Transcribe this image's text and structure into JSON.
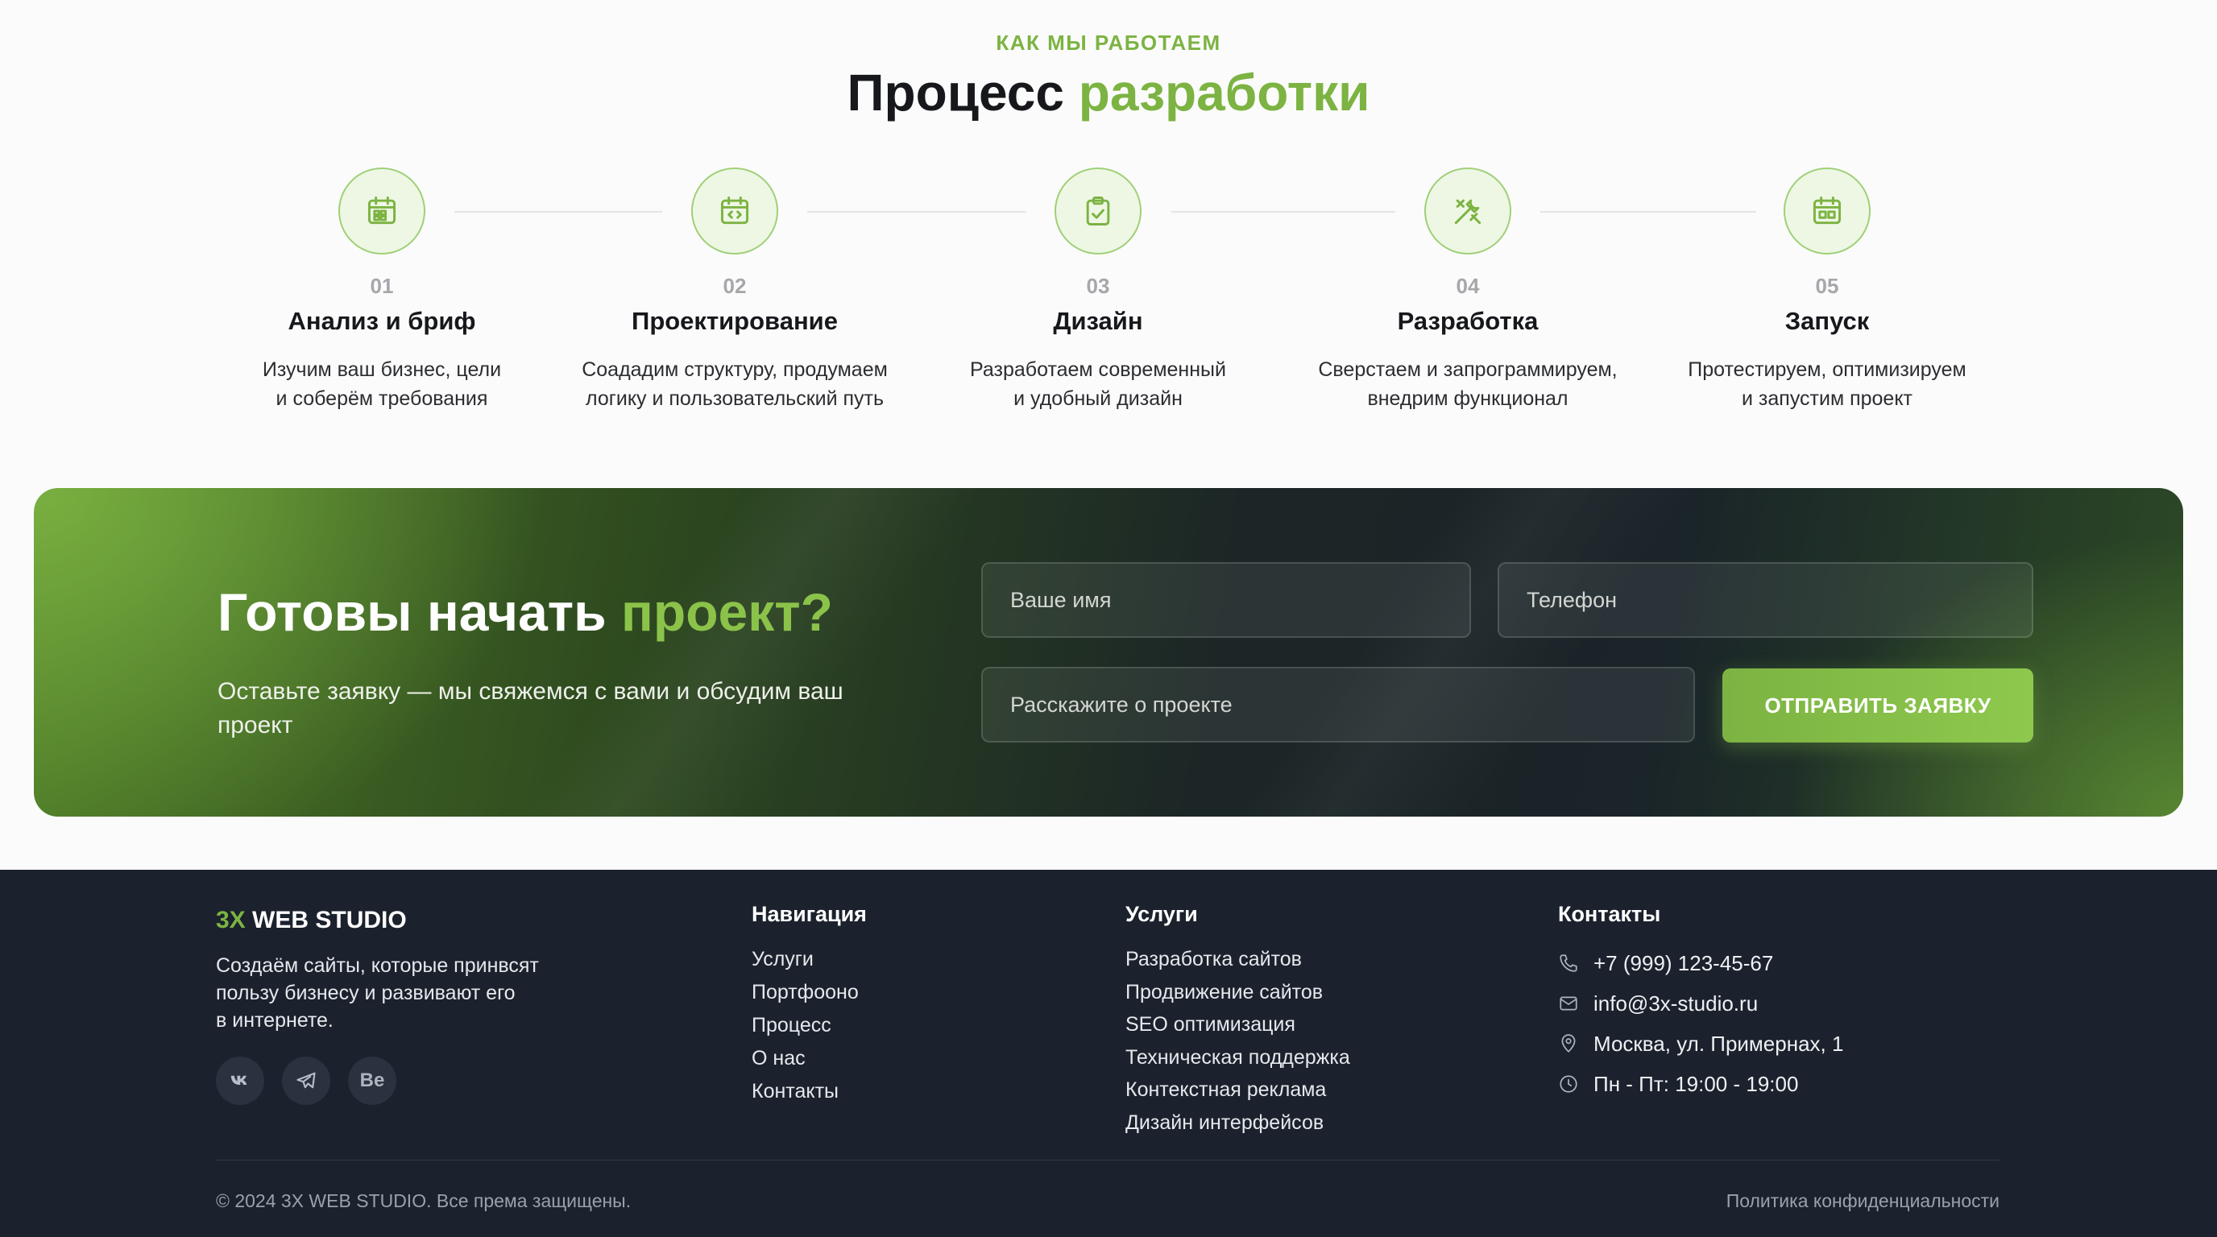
{
  "process": {
    "eyebrow": "КАК МЫ РАБОТАЕМ",
    "heading_main": "Процесс",
    "heading_accent": "разработки",
    "steps": [
      {
        "num": "01",
        "title": "Анализ и бриф",
        "desc": "Изучим ваш бизнес, цели\nи соберём требования",
        "icon": "calendar-grid-icon"
      },
      {
        "num": "02",
        "title": "Проектирование",
        "desc": "Соададим структуру, продумаем\nлогику и пользовательский путь",
        "icon": "calendar-code-icon"
      },
      {
        "num": "03",
        "title": "Дизайн",
        "desc": "Разработаем современный\nи удобный дизайн",
        "icon": "clipboard-check-icon"
      },
      {
        "num": "04",
        "title": "Разработка",
        "desc": "Сверстаем и запрограммируем,\nвнедрим функционал",
        "icon": "tools-icon"
      },
      {
        "num": "05",
        "title": "Запуск",
        "desc": "Протестируем, оптимизируем\nи запустим проект",
        "icon": "calendar-launch-icon"
      }
    ]
  },
  "cta": {
    "title_main": "Готовы начать",
    "title_accent": "проект?",
    "subtitle": "Оставьте заявку — мы свяжемся с вами и обсудим ваш проект",
    "name_placeholder": "Ваше имя",
    "phone_placeholder": "Телефон",
    "message_placeholder": "Расскажите о проекте",
    "submit_label": "ОТПРАВИТЬ ЗАЯВКУ"
  },
  "footer": {
    "brand_accent": "3X",
    "brand_rest": "WEB STUDIO",
    "brand_text": "Создаём сайты, которые принвсят\nпользу бизнесу и развивают его\nв интернете.",
    "socials": [
      "VK",
      "Telegram",
      "Be"
    ],
    "nav": {
      "title": "Навигация",
      "items": [
        "Услуги",
        "Портфооно",
        "Процесс",
        "О нас",
        "Контакты"
      ]
    },
    "services": {
      "title": "Услуги",
      "items": [
        "Разработка сайтов",
        "Продвижение сайтов",
        "SEO оптимизация",
        "Техническая поддержка",
        "Контекстная реклама",
        "Дизайн интерфейсов"
      ]
    },
    "contacts": {
      "title": "Контакты",
      "phone": "+7 (999) 123-45-67",
      "email": "info@3x-studio.ru",
      "address": "Москва, ул. Примернах, 1",
      "hours": "Пн - Пт: 19:00 - 19:00"
    },
    "copyright": "© 2024 3X WEB STUDIO. Все према защищены.",
    "policy": "Политика конфиденциальности"
  },
  "colors": {
    "accent": "#7cb342",
    "footer_bg": "#1b222d"
  }
}
